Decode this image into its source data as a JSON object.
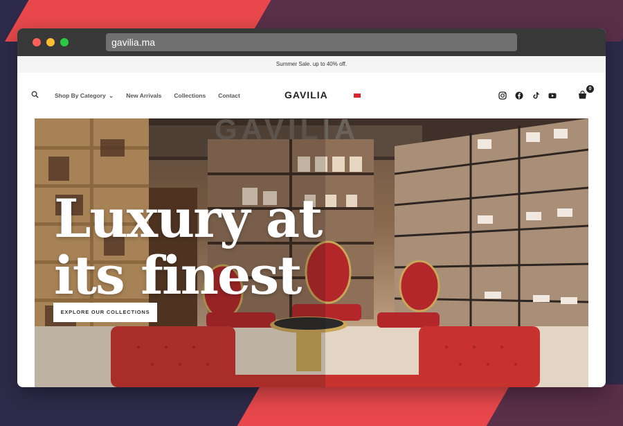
{
  "browser": {
    "url": "gavilia.ma"
  },
  "announcement": "Summer Sale. up to 40% off.",
  "nav": {
    "links": [
      "Shop By Category",
      "New Arrivals",
      "Collections",
      "Contact"
    ],
    "logo": "GAVILIA",
    "cart_count": "0",
    "social_icons": [
      "instagram-icon",
      "facebook-icon",
      "tiktok-icon",
      "youtube-icon"
    ]
  },
  "hero": {
    "title_line1": "Luxury at",
    "title_line2": "its finest",
    "button_label": "EXPLORE OUR COLLECTIONS",
    "sign_text": "GAVILIA"
  },
  "colors": {
    "accent_red": "#e8484c",
    "seat_red": "#b3262a",
    "flag_red": "#d8262c",
    "bg_dark": "#2e2b4a"
  }
}
